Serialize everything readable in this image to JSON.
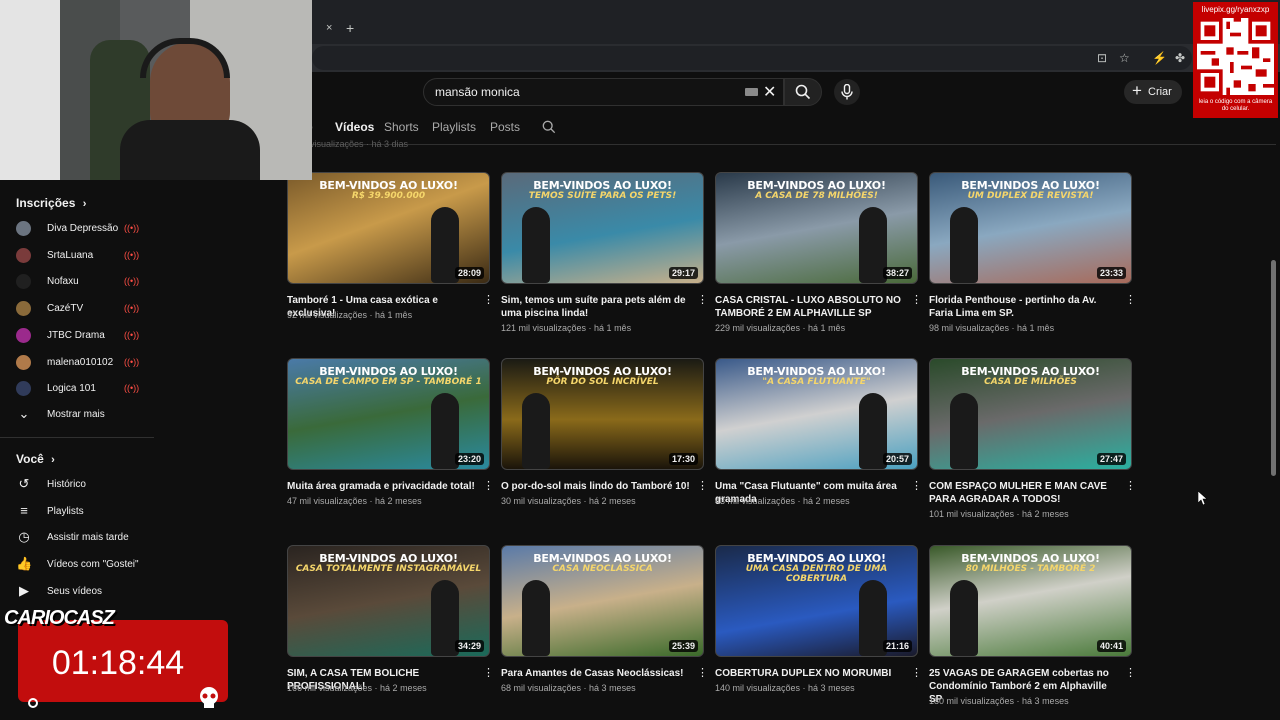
{
  "browser": {
    "tab_close": "×",
    "new_tab": "+"
  },
  "header": {
    "search_value": "mansão monica",
    "clear": "✕",
    "create_label": "Criar"
  },
  "channel_tabs": [
    "o",
    "Vídeos",
    "Shorts",
    "Playlists",
    "Posts"
  ],
  "old_meta": "visualizações · há 3 dias",
  "sidebar": {
    "subs_heading": "Inscrições",
    "subs": [
      {
        "label": "Diva Depressão",
        "color": "#6b7480"
      },
      {
        "label": "SrtaLuana",
        "color": "#7a3b3b"
      },
      {
        "label": "Nofaxu",
        "color": "#202020"
      },
      {
        "label": "CazéTV",
        "color": "#8a6a3a"
      },
      {
        "label": "JTBC Drama",
        "color": "#9b2a8c"
      },
      {
        "label": "malena010102",
        "color": "#b07a4a"
      },
      {
        "label": "Logica 101",
        "color": "#303b5a"
      }
    ],
    "show_more": "Mostrar mais",
    "you_heading": "Você",
    "you": [
      {
        "label": "Histórico",
        "icon": "history-icon",
        "glyph": "↺"
      },
      {
        "label": "Playlists",
        "icon": "playlists-icon",
        "glyph": "≡"
      },
      {
        "label": "Assistir mais tarde",
        "icon": "clock-icon",
        "glyph": "◷"
      },
      {
        "label": "Vídeos com \"Gostei\"",
        "icon": "thumbs-up-icon",
        "glyph": "👍"
      },
      {
        "label": "Seus vídeos",
        "icon": "your-videos-icon",
        "glyph": "▶"
      }
    ]
  },
  "videos": [
    {
      "t1": "BEM-VINDOS AO LUXO!",
      "t2": "R$ 39.900.000",
      "duration": "28:09",
      "title": "Tamboré 1 - Uma casa exótica e exclusiva!",
      "views": "92 mil visualizações",
      "age": "há 1 mês",
      "bg": "linear-gradient(160deg,#7a5a2a,#c89a4a 45%,#3a2a14)"
    },
    {
      "t1": "BEM-VINDOS AO LUXO!",
      "t2": "TEMOS SUÍTE PARA OS PETS!",
      "duration": "29:17",
      "title": "Sim, temos um suíte para pets além de uma piscina linda!",
      "views": "121 mil visualizações",
      "age": "há 1 mês",
      "bg": "linear-gradient(170deg,#5a6a7a,#3a8aa8 55%,#c8b08a)"
    },
    {
      "t1": "BEM-VINDOS AO LUXO!",
      "t2": "A CASA DE 78 MILHÕES!",
      "duration": "38:27",
      "title": "CASA CRISTAL - LUXO ABSOLUTO NO TAMBORÉ 2 EM ALPHAVILLE SP",
      "views": "229 mil visualizações",
      "age": "há 1 mês",
      "bg": "linear-gradient(170deg,#2a3a4a,#8a9aa8 50%,#4a6a3a)"
    },
    {
      "t1": "BEM-VINDOS AO LUXO!",
      "t2": "UM DUPLEX DE REVISTA!",
      "duration": "23:33",
      "title": "Florida Penthouse - pertinho da Av. Faria Lima em SP.",
      "views": "98 mil visualizações",
      "age": "há 1 mês",
      "bg": "linear-gradient(170deg,#3a5a7a,#8aa8c0 50%,#a86a5a)"
    },
    {
      "t1": "BEM-VINDOS AO LUXO!",
      "t2": "CASA DE CAMPO EM SP - TAMBORÉ 1",
      "duration": "23:20",
      "title": "Muita área gramada e privacidade total!",
      "views": "47 mil visualizações",
      "age": "há 2 meses",
      "bg": "linear-gradient(170deg,#4a7aa8,#3a6a3a 50%,#2a8aa0)"
    },
    {
      "t1": "BEM-VINDOS AO LUXO!",
      "t2": "PÔR DO SOL INCRÍVEL",
      "duration": "17:30",
      "title": "O por-do-sol mais lindo do Tamboré 10!",
      "views": "30 mil visualizações",
      "age": "há 2 meses",
      "bg": "linear-gradient(180deg,#1a1a14,#8a6a1a 55%,#1a140a)"
    },
    {
      "t1": "BEM-VINDOS AO LUXO!",
      "t2": "\"A CASA FLUTUANTE\"",
      "duration": "20:57",
      "title": "Uma \"Casa Flutuante\" com muita área gramada",
      "views": "43 mil visualizações",
      "age": "há 2 meses",
      "bg": "linear-gradient(170deg,#3a5a8a,#d0d0d0 50%,#4aa0c0)"
    },
    {
      "t1": "BEM-VINDOS AO LUXO!",
      "t2": "CASA DE MILHÕES",
      "duration": "27:47",
      "title": "COM ESPAÇO MULHER E MAN CAVE PARA AGRADAR A TODOS!",
      "views": "101 mil visualizações",
      "age": "há 2 meses",
      "bg": "linear-gradient(170deg,#2a4a2a,#6a6a6a 50%,#2ab0a0)"
    },
    {
      "t1": "BEM-VINDOS AO LUXO!",
      "t2": "CASA TOTALMENTE INSTAGRAMÁVEL",
      "duration": "34:29",
      "title": "SIM, A CASA TEM BOLICHE PROFISSIONAL!",
      "views": "166 mil visualizações",
      "age": "há 2 meses",
      "bg": "linear-gradient(170deg,#2a2420,#5a4a3a 50%,#1a6a5a)"
    },
    {
      "t1": "BEM-VINDOS AO LUXO!",
      "t2": "CASA NEOCLÁSSICA",
      "duration": "25:39",
      "title": "Para Amantes de Casas Neoclássicas!",
      "views": "68 mil visualizações",
      "age": "há 3 meses",
      "bg": "linear-gradient(170deg,#5a7aa8,#c8b08a 50%,#3a6a2a)"
    },
    {
      "t1": "BEM-VINDOS AO LUXO!",
      "t2": "UMA CASA DENTRO DE UMA COBERTURA",
      "duration": "21:16",
      "title": "COBERTURA DUPLEX NO MORUMBI",
      "views": "140 mil visualizações",
      "age": "há 3 meses",
      "bg": "linear-gradient(170deg,#1a2a4a,#2a5ac0 60%,#1a1a2a)"
    },
    {
      "t1": "BEM-VINDOS AO LUXO!",
      "t2": "80 MILHÕES - TAMBORÉ 2",
      "duration": "40:41",
      "title": "25 VAGAS DE GARAGEM cobertas no Condomínio Tamboré 2 em Alphaville SP",
      "views": "180 mil visualizações",
      "age": "há 3 meses",
      "bg": "linear-gradient(170deg,#3a5a2a,#d0d0c8 45%,#4a7a3a)"
    }
  ],
  "overlays": {
    "qr_url": "livepix.gg/ryanxzxp",
    "qr_caption": "leia o código com a câmera do celular.",
    "timer": "01:18:44",
    "caption": "CARIOCASZ"
  }
}
